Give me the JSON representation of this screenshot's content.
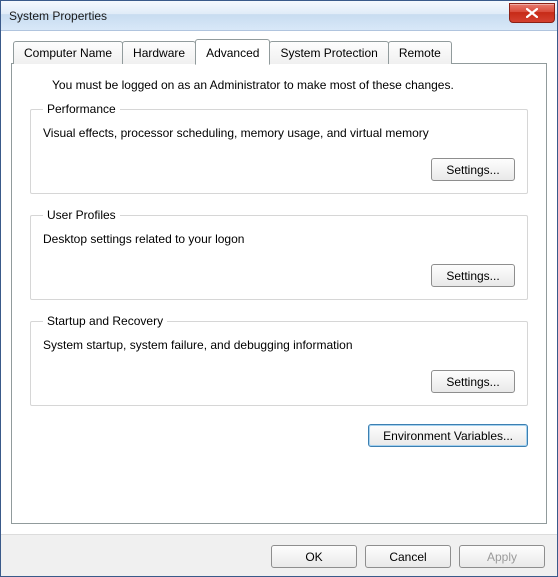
{
  "window": {
    "title": "System Properties"
  },
  "tabs": {
    "computer_name": "Computer Name",
    "hardware": "Hardware",
    "advanced": "Advanced",
    "system_protection": "System Protection",
    "remote": "Remote"
  },
  "advanced": {
    "intro": "You must be logged on as an Administrator to make most of these changes.",
    "performance": {
      "legend": "Performance",
      "desc": "Visual effects, processor scheduling, memory usage, and virtual memory",
      "settings_label": "Settings..."
    },
    "user_profiles": {
      "legend": "User Profiles",
      "desc": "Desktop settings related to your logon",
      "settings_label": "Settings..."
    },
    "startup_recovery": {
      "legend": "Startup and Recovery",
      "desc": "System startup, system failure, and debugging information",
      "settings_label": "Settings..."
    },
    "env_vars_label": "Environment Variables..."
  },
  "footer": {
    "ok": "OK",
    "cancel": "Cancel",
    "apply": "Apply"
  }
}
